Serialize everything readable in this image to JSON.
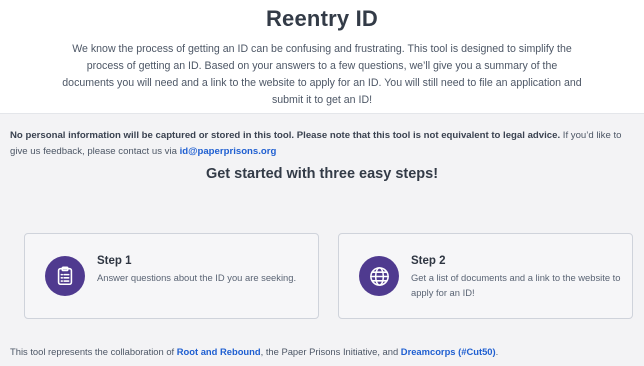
{
  "hero": {
    "title": "Reentry ID",
    "intro": "We know the process of getting an ID can be confusing and frustrating. This tool is designed to simplify the process of getting an ID. Based on your answers to a few questions, we’ll give you a summary of the documents you will need and a link to the website to apply for an ID. You will still need to file an application and submit it to get an ID!"
  },
  "notice": {
    "bold_text": "No personal information will be captured or stored in this tool. Please note that this tool is not equivalent to legal advice.",
    "text": " If you’d like to give us feedback, please contact us via ",
    "email": "id@paperprisons.org"
  },
  "steps_heading": "Get started with three easy steps!",
  "steps": [
    {
      "title": "Step 1",
      "description": "Answer questions about the ID you are seeking.",
      "icon": "clipboard-icon"
    },
    {
      "title": "Step 2",
      "description": "Get a list of documents and a link to the website to apply for an ID!",
      "icon": "globe-icon"
    }
  ],
  "footer": {
    "prefix": "This tool represents the collaboration of ",
    "link1": "Root and Rebound",
    "middle": ", the Paper Prisons Initiative, and ",
    "link2": "Dreamcorps (#Cut50)",
    "suffix": "."
  },
  "colors": {
    "accent": "#4f3a8f",
    "link": "#1f5fd1",
    "panel_bg": "#f3f3f5"
  }
}
